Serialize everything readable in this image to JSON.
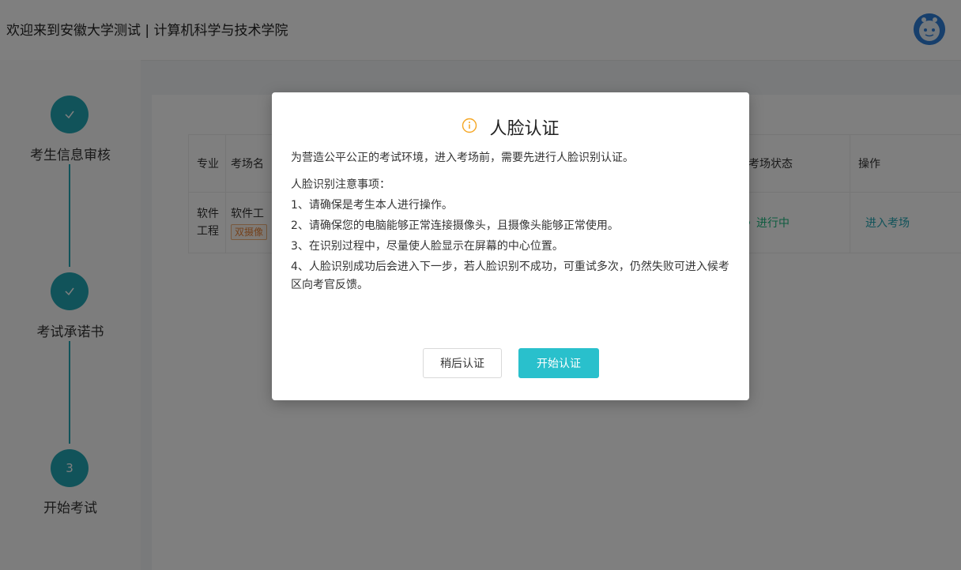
{
  "header": {
    "title": "欢迎来到安徽大学测试 | 计算机科学与技术学院"
  },
  "steps": [
    {
      "label": "考生信息审核",
      "status": "done",
      "icon": "check-icon"
    },
    {
      "label": "考试承诺书",
      "status": "done",
      "icon": "check-icon"
    },
    {
      "label": "开始考试",
      "status": "current",
      "number": "3"
    }
  ],
  "table": {
    "headers": {
      "major": "专业",
      "room": "考场名",
      "status": "考场状态",
      "action": "操作"
    },
    "row": {
      "major_line1": "软件",
      "major_line2": "工程",
      "room": "软件工",
      "tag": "双摄像",
      "status": "进行中",
      "action": "进入考场"
    }
  },
  "modal": {
    "icon": "info-icon",
    "title": "人脸认证",
    "intro": "为营造公平公正的考试环境，进入考场前，需要先进行人脸识别认证。",
    "notes_title": "人脸识别注意事项：",
    "notes": [
      "1、请确保是考生本人进行操作。",
      "2、请确保您的电脑能够正常连接摄像头，且摄像头能够正常使用。",
      "3、在识别过程中，尽量使人脸显示在屏幕的中心位置。",
      "4、人脸识别成功后会进入下一步，若人脸识别不成功，可重试多次，仍然失败可进入候考区向考官反馈。"
    ],
    "later_button": "稍后认证",
    "start_button": "开始认证"
  },
  "colors": {
    "accent": "#23a6b4",
    "primary_button": "#29c0cc",
    "status_green": "#1eb980",
    "tag_orange": "#e8843a",
    "warning_icon": "#f5a623"
  }
}
